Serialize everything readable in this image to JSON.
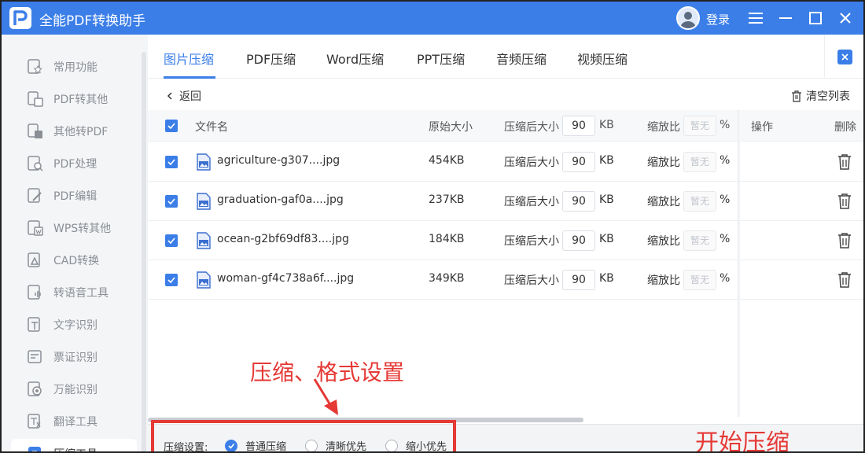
{
  "app": {
    "title": "全能PDF转换助手",
    "login": "登录"
  },
  "sidebar": {
    "items": [
      {
        "label": "常用功能",
        "icon": "star-doc-icon"
      },
      {
        "label": "PDF转其他",
        "icon": "pdf-convert-icon"
      },
      {
        "label": "其他转PDF",
        "icon": "to-pdf-icon"
      },
      {
        "label": "PDF处理",
        "icon": "pdf-process-icon"
      },
      {
        "label": "PDF编辑",
        "icon": "pdf-edit-icon"
      },
      {
        "label": "WPS转其他",
        "icon": "wps-icon"
      },
      {
        "label": "CAD转换",
        "icon": "cad-icon"
      },
      {
        "label": "转语音工具",
        "icon": "voice-icon"
      },
      {
        "label": "文字识别",
        "icon": "ocr-icon"
      },
      {
        "label": "票证识别",
        "icon": "ticket-icon"
      },
      {
        "label": "万能识别",
        "icon": "universal-scan-icon"
      },
      {
        "label": "翻译工具",
        "icon": "translate-icon"
      },
      {
        "label": "压缩工具",
        "icon": "compress-icon"
      }
    ]
  },
  "tabs": [
    {
      "label": "图片压缩",
      "active": true
    },
    {
      "label": "PDF压缩",
      "active": false
    },
    {
      "label": "Word压缩",
      "active": false
    },
    {
      "label": "PPT压缩",
      "active": false
    },
    {
      "label": "音频压缩",
      "active": false
    },
    {
      "label": "视频压缩",
      "active": false
    }
  ],
  "toolbar": {
    "back": "返回",
    "clear": "清空列表"
  },
  "table": {
    "headers": {
      "filename": "文件名",
      "original": "原始大小",
      "compressed": "压缩后大小",
      "compressed_value": "90",
      "unit": "KB",
      "ratio": "缩放比",
      "ratio_placeholder": "暂无",
      "percent": "%",
      "action": "操作",
      "delete": "删除"
    },
    "rows": [
      {
        "name": "agriculture-g307....jpg",
        "size": "454KB",
        "label": "压缩后大小",
        "value": "90",
        "unit": "KB",
        "ratio_label": "缩放比",
        "ratio": "暂无",
        "percent": "%"
      },
      {
        "name": "graduation-gaf0a....jpg",
        "size": "237KB",
        "label": "压缩后大小",
        "value": "90",
        "unit": "KB",
        "ratio_label": "缩放比",
        "ratio": "暂无",
        "percent": "%"
      },
      {
        "name": "ocean-g2bf69df83....jpg",
        "size": "184KB",
        "label": "压缩后大小",
        "value": "90",
        "unit": "KB",
        "ratio_label": "缩放比",
        "ratio": "暂无",
        "percent": "%"
      },
      {
        "name": "woman-gf4c738a6f....jpg",
        "size": "349KB",
        "label": "压缩后大小",
        "value": "90",
        "unit": "KB",
        "ratio_label": "缩放比",
        "ratio": "暂无",
        "percent": "%"
      }
    ]
  },
  "settings": {
    "label": "压缩设置:",
    "options": [
      "普通压缩",
      "清晰优先",
      "缩小优先"
    ],
    "selected": "普通压缩"
  },
  "annotations": {
    "settings": "压缩、格式设置",
    "start": "开始压缩"
  },
  "colors": {
    "accent": "#3b7ee8",
    "annotation": "#e53935"
  }
}
